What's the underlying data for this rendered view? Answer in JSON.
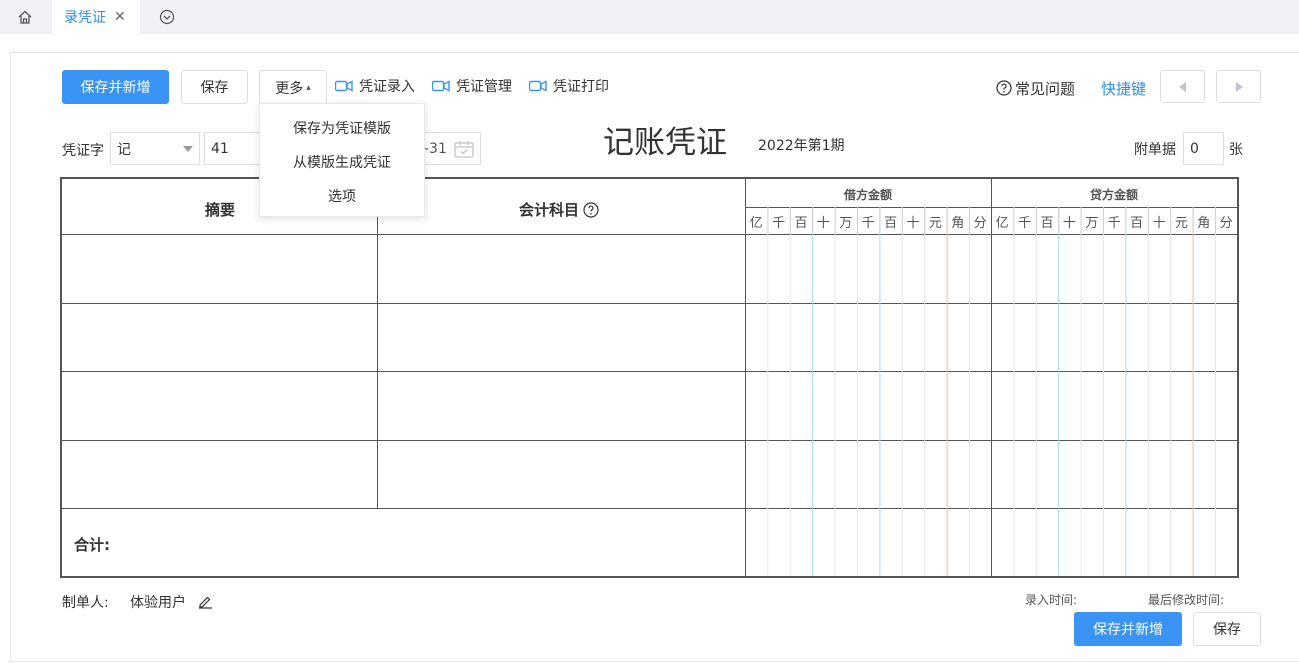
{
  "tabs": {
    "active_label": "录凭证",
    "close_glyph": "✕"
  },
  "toolbar": {
    "save_new_label": "保存并新增",
    "save_label": "保存",
    "more_label": "更多",
    "more_arrow": "▴",
    "voucher_entry": "凭证录入",
    "voucher_manage": "凭证管理",
    "voucher_print": "凭证打印",
    "faq_label": "常见问题",
    "shortcut_label": "快捷键"
  },
  "more_menu": {
    "items": [
      "保存为凭证模版",
      "从模版生成凭证",
      "选项"
    ]
  },
  "voucher": {
    "word_label": "凭证字",
    "word_value": "记",
    "number_value": "41",
    "date_partial": "-31",
    "title": "记账凭证",
    "period": "2022年第1期",
    "attachments_label": "附单据",
    "attachments_value": "0",
    "attachments_unit": "张"
  },
  "table": {
    "col_summary": "摘要",
    "col_account": "会计科目",
    "debit_label": "借方金额",
    "credit_label": "贷方金额",
    "digits": [
      "亿",
      "千",
      "百",
      "十",
      "万",
      "千",
      "百",
      "十",
      "元",
      "角",
      "分"
    ],
    "total_label": "合计:"
  },
  "footer": {
    "maker_label": "制单人:",
    "maker_value": "体验用户",
    "entry_time_label": "录入时间:",
    "modified_time_label": "最后修改时间:",
    "save_new_label": "保存并新增",
    "save_label": "保存"
  },
  "colors": {
    "primary": "#3a94f5",
    "link": "#2d8cf0",
    "grid_blue": "#a8d8ef",
    "grid_red": "#f0b8a0"
  }
}
